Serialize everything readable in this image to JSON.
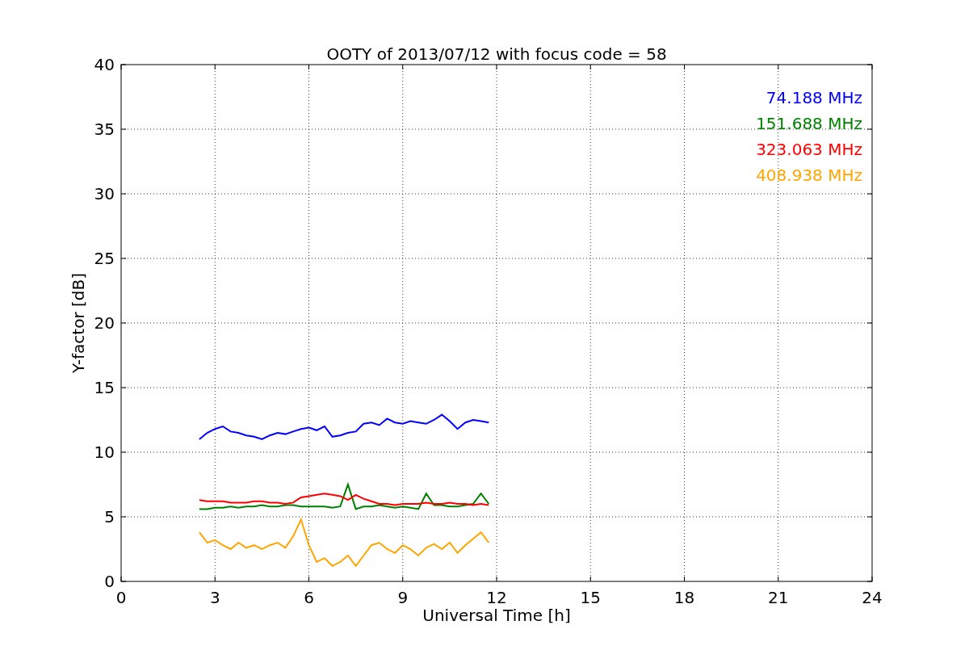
{
  "chart_data": {
    "type": "line",
    "title": "OOTY of 2013/07/12 with focus code = 58",
    "xlabel": "Universal Time [h]",
    "ylabel": "Y-factor [dB]",
    "grid": true,
    "xlim": [
      0,
      24
    ],
    "ylim": [
      0,
      40
    ],
    "xticks": [
      0,
      3,
      6,
      9,
      12,
      15,
      18,
      21,
      24
    ],
    "yticks": [
      0,
      5,
      10,
      15,
      20,
      25,
      30,
      35,
      40
    ],
    "x": [
      2.5,
      2.75,
      3,
      3.25,
      3.5,
      3.75,
      4,
      4.25,
      4.5,
      4.75,
      5,
      5.25,
      5.5,
      5.75,
      6,
      6.25,
      6.5,
      6.75,
      7,
      7.25,
      7.5,
      7.75,
      8,
      8.25,
      8.5,
      8.75,
      9,
      9.25,
      9.5,
      9.75,
      10,
      10.25,
      10.5,
      10.75,
      11,
      11.25,
      11.5,
      11.75
    ],
    "series": [
      {
        "name": "74.188 MHz",
        "color": "#0000ff",
        "values": [
          11,
          11.5,
          11.8,
          12,
          11.6,
          11.5,
          11.3,
          11.2,
          11,
          11.3,
          11.5,
          11.4,
          11.6,
          11.8,
          11.9,
          11.7,
          12,
          11.2,
          11.3,
          11.5,
          11.6,
          12.2,
          12.3,
          12.1,
          12.6,
          12.3,
          12.2,
          12.4,
          12.3,
          12.2,
          12.5,
          12.9,
          12.4,
          11.8,
          12.3,
          12.5,
          12.4,
          12.3
        ]
      },
      {
        "name": "151.688 MHz",
        "color": "#008000",
        "values": [
          5.6,
          5.6,
          5.7,
          5.7,
          5.8,
          5.7,
          5.8,
          5.8,
          5.9,
          5.8,
          5.8,
          5.9,
          5.9,
          5.8,
          5.8,
          5.8,
          5.8,
          5.7,
          5.8,
          7.5,
          5.6,
          5.8,
          5.8,
          5.9,
          5.8,
          5.7,
          5.8,
          5.7,
          5.6,
          6.8,
          5.9,
          5.9,
          5.8,
          5.8,
          5.9,
          6,
          6.8,
          6
        ]
      },
      {
        "name": "323.063 MHz",
        "color": "#ff0000",
        "values": [
          6.3,
          6.2,
          6.2,
          6.2,
          6.1,
          6.1,
          6.1,
          6.2,
          6.2,
          6.1,
          6.1,
          6,
          6.1,
          6.5,
          6.6,
          6.7,
          6.8,
          6.7,
          6.6,
          6.3,
          6.7,
          6.4,
          6.2,
          6,
          6,
          5.9,
          6,
          6,
          6,
          6.1,
          6,
          6,
          6.1,
          6,
          6,
          5.9,
          6,
          5.9
        ]
      },
      {
        "name": "408.938 MHz",
        "color": "#ffa500",
        "values": [
          3.8,
          3,
          3.2,
          2.8,
          2.5,
          3,
          2.6,
          2.8,
          2.5,
          2.8,
          3,
          2.6,
          3.5,
          4.8,
          2.8,
          1.5,
          1.8,
          1.2,
          1.5,
          2,
          1.2,
          2,
          2.8,
          3,
          2.5,
          2.2,
          2.8,
          2.5,
          2,
          2.6,
          2.9,
          2.5,
          3,
          2.2,
          2.8,
          3.3,
          3.8,
          3
        ]
      }
    ]
  }
}
